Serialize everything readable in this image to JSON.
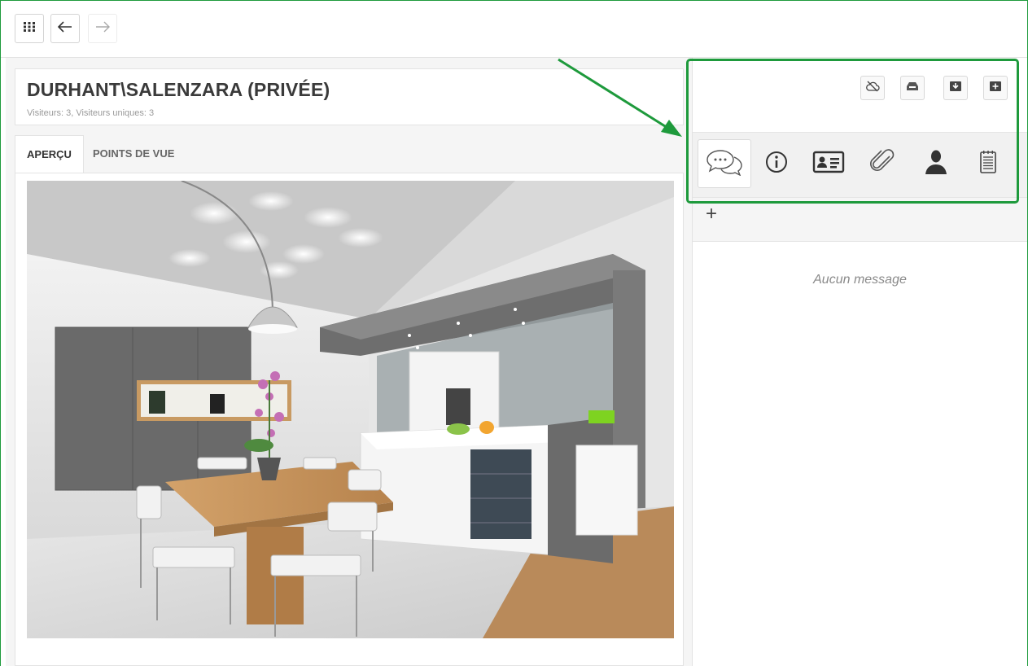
{
  "toolbar": {
    "apps_icon": "grid-icon",
    "back_icon": "arrow-left-icon",
    "forward_icon": "arrow-right-icon"
  },
  "header": {
    "title": "DURHANT\\SALENZARA (PRIVÉE)",
    "subtitle": "Visiteurs: 3, Visiteurs uniques: 3"
  },
  "tabs": [
    {
      "label": "APERÇU",
      "active": true
    },
    {
      "label": "POINTS DE VUE",
      "active": false
    }
  ],
  "preview": {
    "image": "kitchen-render-image"
  },
  "side_toolbar": {
    "actions": [
      "cloud-off-icon",
      "inbox-icon",
      "download-box-icon",
      "add-box-icon"
    ]
  },
  "side_tabs": [
    {
      "icon": "comments-icon",
      "active": true
    },
    {
      "icon": "info-icon",
      "active": false
    },
    {
      "icon": "id-card-icon",
      "active": false
    },
    {
      "icon": "paperclip-icon",
      "active": false
    },
    {
      "icon": "user-icon",
      "active": false
    },
    {
      "icon": "notepad-icon",
      "active": false
    }
  ],
  "messages": {
    "add_label": "+",
    "empty_text": "Aucun message"
  },
  "colors": {
    "annotation": "#1e9a3c",
    "border": "#e3e3e3",
    "text": "#3a3a3a"
  }
}
